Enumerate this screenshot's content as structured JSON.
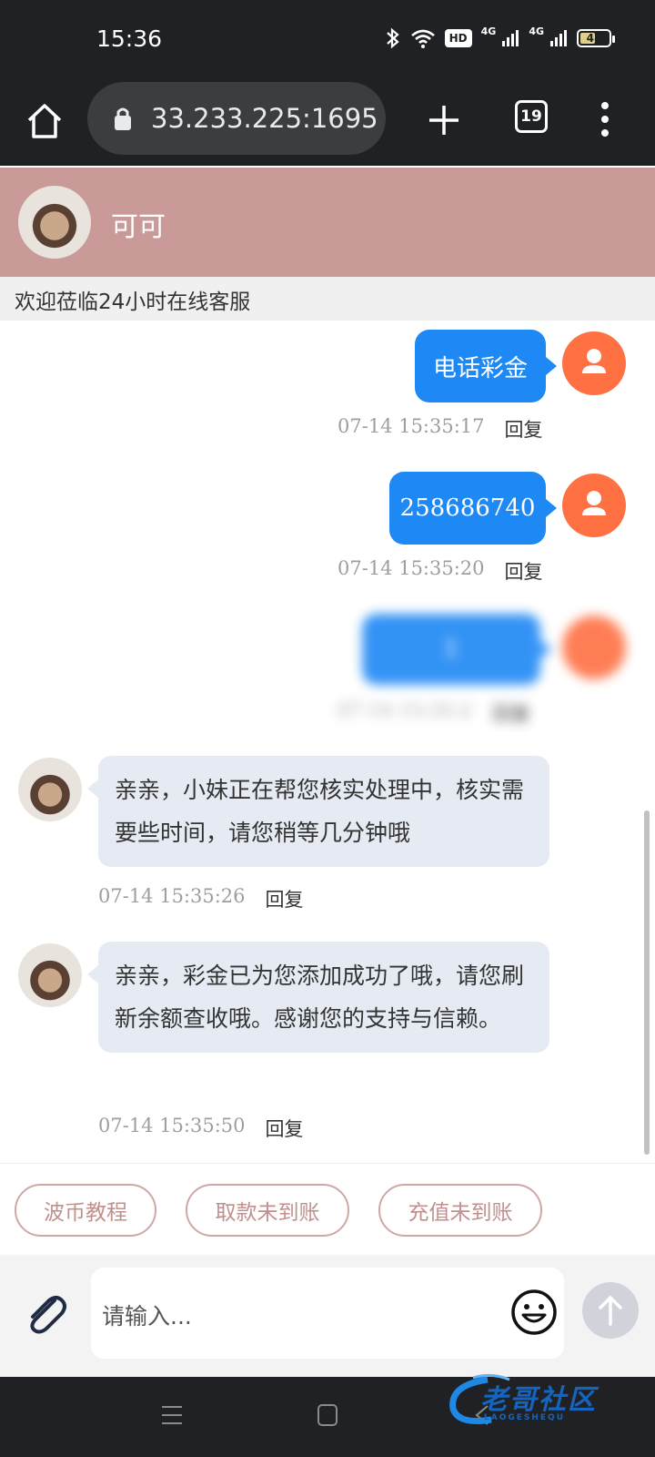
{
  "status_bar": {
    "time": "15:36",
    "network_1": "4G",
    "network_2": "4G",
    "hd_label": "HD",
    "battery": "48"
  },
  "browser": {
    "url": "33.233.225:1695",
    "tab_count": "19"
  },
  "chat": {
    "agent_name": "可可",
    "welcome": "欢迎莅临24小时在线客服"
  },
  "messages": {
    "outgoing": [
      {
        "text": "电话彩金",
        "time": "07-14 15:35:17",
        "reply": "回复"
      },
      {
        "text": "258686740",
        "time": "07-14 15:35:20",
        "reply": "回复"
      },
      {
        "text": "1",
        "time": "07-14 15:35:2",
        "reply": "回复"
      }
    ],
    "incoming": [
      {
        "text": "亲亲，小妹正在帮您核实处理中，核实需要些时间，请您稍等几分钟哦",
        "time": "07-14 15:35:26",
        "reply": "回复"
      },
      {
        "text": "亲亲，彩金已为您添加成功了哦，请您刷新余额查收哦。感谢您的支持与信赖。",
        "time": "07-14 15:35:50",
        "reply": "回复"
      }
    ]
  },
  "quick_replies": [
    "波币教程",
    "取款未到账",
    "充值未到账"
  ],
  "input": {
    "placeholder": "请输入..."
  },
  "watermark": {
    "text": "老哥社区",
    "sub": "LAOGESHEQU"
  },
  "colors": {
    "header": "#c99a98",
    "outgoing_bubble": "#1e88f5",
    "user_avatar": "#ff7043",
    "incoming_bubble": "#e6ebf3",
    "quick_border": "#cfa7a4"
  }
}
